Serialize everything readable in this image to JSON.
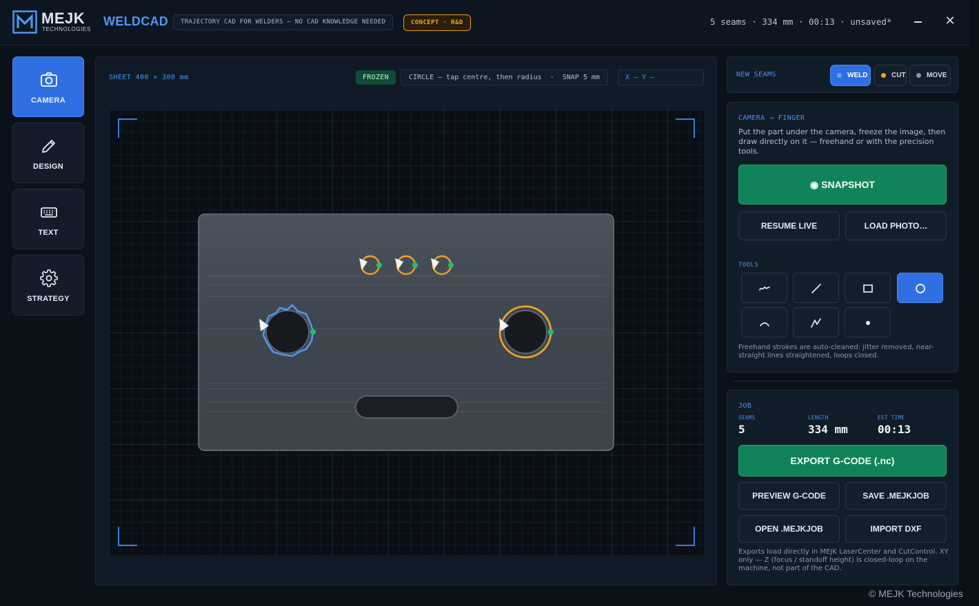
{
  "header": {
    "logo_word": "MEJK",
    "logo_sub": "TECHNOLOGIES",
    "app_title": "WELDCAD",
    "tagline": "TRAJECTORY CAD FOR WELDERS — NO CAD KNOWLEDGE NEEDED",
    "concept_badge": "CONCEPT · R&D",
    "status": "5 seams · 334 mm · 00:13 · unsaved*",
    "close_glyph": "✕"
  },
  "nav": [
    {
      "label": "CAMERA",
      "icon": "camera-icon",
      "active": true
    },
    {
      "label": "DESIGN",
      "icon": "pencil-icon",
      "active": false
    },
    {
      "label": "TEXT",
      "icon": "keyboard-icon",
      "active": false
    },
    {
      "label": "STRATEGY",
      "icon": "gear-icon",
      "active": false
    }
  ],
  "workspace": {
    "sheet_label": "SHEET 400 × 300 mm",
    "frozen_badge": "FROZEN",
    "tool_hint": "CIRCLE — tap centre, then radius  ·  SNAP 5 mm",
    "coords": "X —  Y —"
  },
  "seams_panel": {
    "label": "NEW SEAMS",
    "modes": [
      {
        "label": "WELD",
        "color": "#4f97f2",
        "active": true
      },
      {
        "label": "CUT",
        "color": "#f0a525",
        "active": false
      },
      {
        "label": "MOVE",
        "color": "#8a93a0",
        "active": false
      }
    ]
  },
  "camera_panel": {
    "label": "CAMERA → FINGER",
    "description": "Put the part under the camera, freeze the image, then draw directly on it — freehand or with the precision tools.",
    "snapshot_label": "◉ SNAPSHOT",
    "resume_label": "RESUME LIVE",
    "load_label": "LOAD PHOTO…",
    "tools_label": "TOOLS",
    "tools": [
      {
        "name": "freehand-tool",
        "icon": "freehand-icon",
        "active": false
      },
      {
        "name": "line-tool",
        "icon": "line-icon",
        "active": false
      },
      {
        "name": "rectangle-tool",
        "icon": "rectangle-icon",
        "active": false
      },
      {
        "name": "circle-tool",
        "icon": "circle-icon",
        "active": true
      },
      {
        "name": "arc-tool",
        "icon": "arc-icon",
        "active": false
      },
      {
        "name": "polyline-tool",
        "icon": "polyline-icon",
        "active": false
      },
      {
        "name": "point-tool",
        "icon": "point-icon",
        "active": false
      }
    ],
    "note": "Freehand strokes are auto-cleaned: jitter removed, near-straight lines straightened, loops closed."
  },
  "job_panel": {
    "label": "JOB",
    "seams_label": "SEAMS",
    "seams_value": "5",
    "length_label": "LENGTH",
    "length_value": "334 mm",
    "time_label": "EST TIME",
    "time_value": "00:13",
    "export_label": "EXPORT G-CODE (.nc)",
    "preview_label": "PREVIEW G-CODE",
    "save_label": "SAVE .MEJKJOB",
    "open_label": "OPEN .MEJKJOB",
    "import_label": "IMPORT DXF",
    "note": "Exports load directly in MEJK LaserCenter and CutControl. XY only — Z (focus / standoff height) is closed-loop on the machine, not part of the CAD."
  },
  "footer": {
    "copyright": "© MEJK Technologies"
  },
  "colors": {
    "accent": "#2f6fe3",
    "weld": "#4f97f2",
    "cut": "#f0a525",
    "export": "#11835a",
    "endpoint": "#1fbf76"
  }
}
